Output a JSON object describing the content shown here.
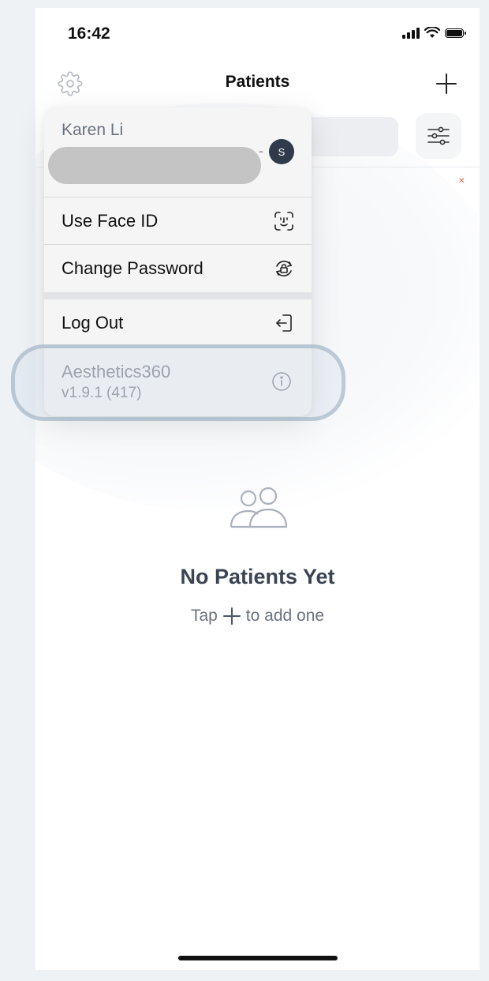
{
  "status_bar": {
    "time": "16:42"
  },
  "nav": {
    "title": "Patients"
  },
  "empty_state": {
    "title": "No Patients Yet",
    "subtitle_before": "Tap",
    "subtitle_after": "to add one"
  },
  "menu": {
    "user_name": "Karen Li",
    "avatar_initial": "S",
    "items": [
      {
        "label": "Use Face ID",
        "icon": "face-id-icon"
      },
      {
        "label": "Change Password",
        "icon": "password-lock-icon"
      },
      {
        "label": "Log Out",
        "icon": "logout-icon"
      }
    ],
    "app": {
      "name": "Aesthetics360",
      "version": "v1.9.1 (417)",
      "icon": "info-icon"
    }
  }
}
